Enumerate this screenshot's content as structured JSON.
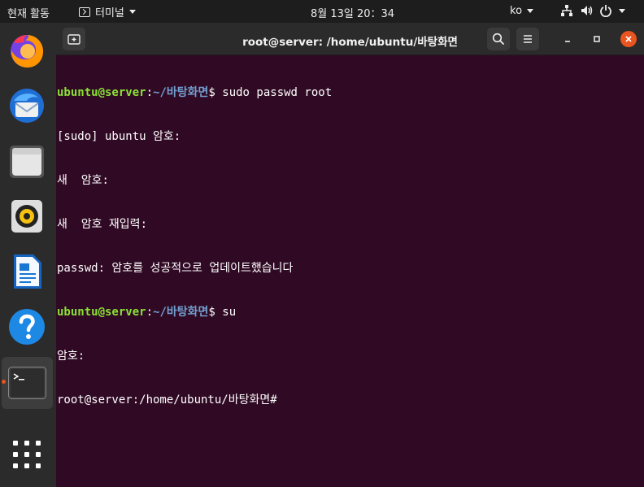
{
  "topbar": {
    "activities": "현재 활동",
    "app_menu": "터미널",
    "clock": "8월 13일  20：34",
    "lang": "ko"
  },
  "window": {
    "title": "root@server: /home/ubuntu/바탕화면"
  },
  "terminal": {
    "lines": [
      {
        "user": "ubuntu@server",
        "sep": ":",
        "path": "~/바탕화면",
        "cmd": "$ sudo passwd root"
      },
      {
        "text": "[sudo] ubuntu 암호:"
      },
      {
        "text": "새  암호:"
      },
      {
        "text": "새  암호 재입력:"
      },
      {
        "text": "passwd: 암호를 성공적으로 업데이트했습니다"
      },
      {
        "user": "ubuntu@server",
        "sep": ":",
        "path": "~/바탕화면",
        "cmd": "$ su"
      },
      {
        "text": "암호:"
      },
      {
        "text": "root@server:/home/ubuntu/바탕화면#"
      }
    ]
  },
  "dock": {
    "items": [
      "firefox",
      "thunderbird",
      "files",
      "rhythmbox",
      "libreoffice-writer",
      "help",
      "terminal",
      "show-applications"
    ]
  },
  "colors": {
    "terminal_bg": "#300a24",
    "prompt_user": "#8ae234",
    "prompt_path": "#729fcf",
    "accent": "#e95420"
  }
}
